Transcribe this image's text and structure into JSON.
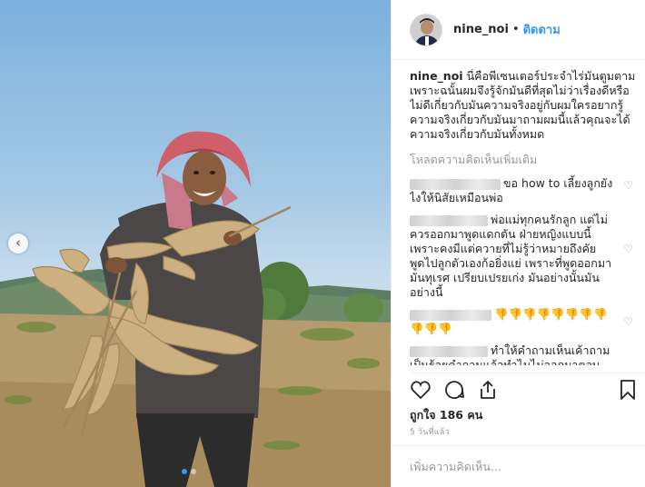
{
  "post": {
    "photo_alt": "",
    "carousel_prev": "‹"
  },
  "header": {
    "username": "nine_noi",
    "separator": "•",
    "follow_label": "ติดตาม"
  },
  "caption": {
    "username": "nine_noi",
    "text": "นี่คือพีเซนเตอร์ประจำไร่มันตูมตาม เพราะฉนั้นผมจึงรู้จักมันดีที่สุดไม่ว่าเรื่องดีหรือไม่ดีเกี่ยวกับมันความจริงอยู่กับผมใครอยากรู้ความจริงเกี่ยวกับมันมาถามผมนี้แล้วคุณจะได้ความจริงเกี่ยวกับมันทั้งหมด"
  },
  "load_more": "โหลดความคิดเห็นเพิ่มเติม",
  "comments": [
    {
      "text": "ขอ how to เลี้ยงลูกยังไงให้นิสัยเหมือนพ่อ"
    },
    {
      "text": "พ่อแม่ทุกคนรักลูก แต่ไม่ควรออกมาพูดแดกดัน ฝ่ายหญิงแบบนี้ เพราะคงมีแต่ควายที่ไม่รู้ว่าหมายถึงคัย พูดไปลูกตัวเองก้อยิ่งแย่ เพราะที่พูดออกมามันทุเรศ เปรียบเปรยเก่ง มันอย่างนั้นมันอย่างนี้"
    },
    {
      "text": "👎👎👎👎👎👎👎👎👎👎👎"
    },
    {
      "text": "ทำให้คำถามเห็นเค้าถาม เป็นร้อยคำถามแล้วทำไมไม่ออกมาตอบ"
    }
  ],
  "icons": {
    "like": "heart-icon",
    "comment": "comment-icon",
    "share": "share-icon",
    "save": "bookmark-icon",
    "comment_like": "heart-small-icon"
  },
  "likes": "ถูกใจ 186 คน",
  "timestamp": "5 วันที่แล้ว",
  "add_comment_placeholder": "เพิ่มความคิดเห็น...",
  "colors": {
    "link": "#3897f0",
    "text": "#262626",
    "muted": "#999999",
    "border": "#efefef"
  }
}
